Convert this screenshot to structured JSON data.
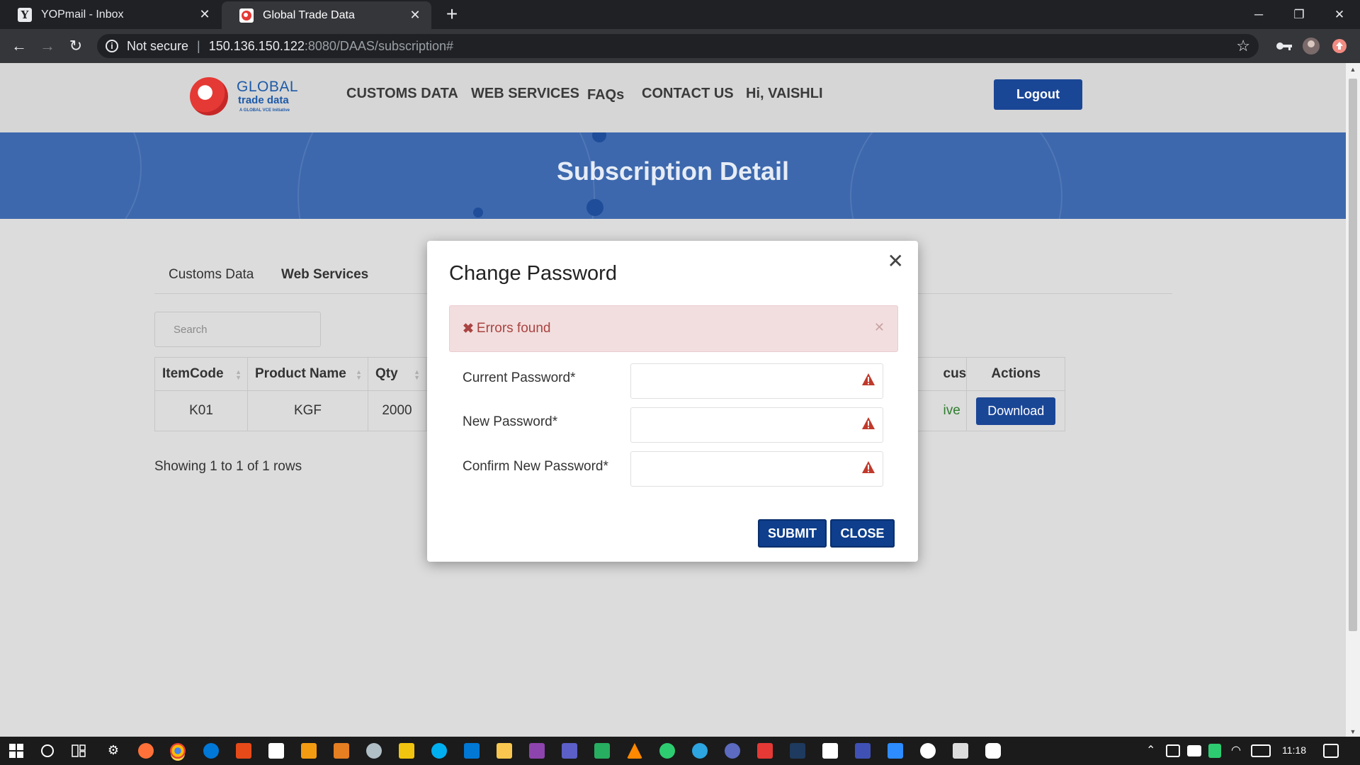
{
  "browser": {
    "tabs": [
      {
        "title": "YOPmail - Inbox",
        "icon": "yopmail-favicon",
        "active": false
      },
      {
        "title": "Global Trade Data",
        "icon": "global-trade-favicon",
        "active": true
      }
    ],
    "address": {
      "security": "Not secure",
      "host": "150.136.150.122",
      "path": ":8080/DAAS/subscription#"
    }
  },
  "site": {
    "logo": {
      "line1": "GLOBAL",
      "line2": "trade data",
      "line3": "A GLOBAL VCE Initiative"
    },
    "nav": [
      "CUSTOMS DATA",
      "WEB SERVICES",
      "FAQs",
      "CONTACT US",
      "Hi, VAISHLI"
    ],
    "logout": "Logout",
    "hero_title": "Subscription Detail"
  },
  "content": {
    "tabs": [
      "Customs Data",
      "Web Services"
    ],
    "search_placeholder": "Search",
    "table": {
      "headers": [
        "ItemCode",
        "Product Name",
        "Qty",
        "cus",
        "Actions"
      ],
      "rows": [
        {
          "item_code": "K01",
          "product_name": "KGF",
          "qty": "2000",
          "status": "ive",
          "action": "Download"
        }
      ]
    },
    "showing": "Showing 1 to 1 of 1 rows"
  },
  "modal": {
    "title": "Change Password",
    "alert": "Errors found",
    "fields": [
      {
        "label": "Current Password*"
      },
      {
        "label": "New Password*"
      },
      {
        "label": "Confirm New Password*"
      }
    ],
    "submit": "SUBMIT",
    "close": "CLOSE"
  },
  "taskbar": {
    "time": "11:18"
  },
  "colors": {
    "brand_blue": "#1a4696",
    "hero_blue": "#3d68ad",
    "error_bg": "#f2dede",
    "error_text": "#a94442",
    "warn_red": "#c0392b"
  }
}
